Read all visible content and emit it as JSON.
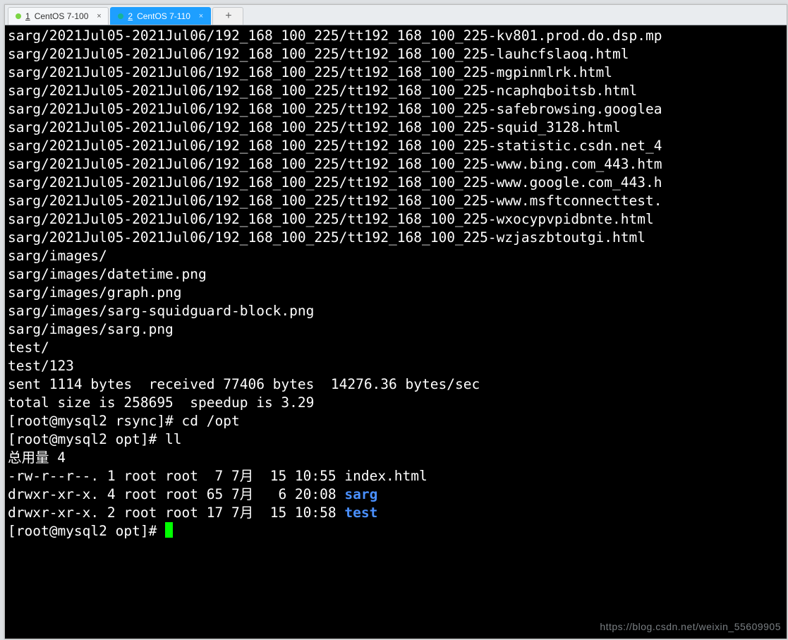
{
  "tabs": [
    {
      "num": "1",
      "label": "CentOS 7-100",
      "dotClass": "dot-green",
      "active": false
    },
    {
      "num": "2",
      "label": "CentOS 7-110",
      "dotClass": "dot-teal",
      "active": true
    }
  ],
  "addTab": "+",
  "sargPrefix": "sarg/2021Jul05-2021Jul06/192_168_100_225/tt192_168_100_225-",
  "sargFiles": [
    "kv801.prod.do.dsp.mp",
    "lauhcfslaoq.html",
    "mgpinmlrk.html",
    "ncaphqboitsb.html",
    "safebrowsing.googlea",
    "squid_3128.html",
    "statistic.csdn.net_4",
    "www.bing.com_443.htm",
    "www.google.com_443.h",
    "www.msftconnecttest.",
    "wxocypvpidbnte.html",
    "wzjaszbtoutgi.html"
  ],
  "extraLines": [
    "sarg/images/",
    "sarg/images/datetime.png",
    "sarg/images/graph.png",
    "sarg/images/sarg-squidguard-block.png",
    "sarg/images/sarg.png",
    "test/",
    "test/123"
  ],
  "blank": "",
  "transfer": {
    "sent": "sent 1114 bytes  received 77406 bytes  14276.36 bytes/sec",
    "total": "total size is 258695  speedup is 3.29"
  },
  "prompts": {
    "p1": "[root@mysql2 rsync]# cd /opt",
    "p2": "[root@mysql2 opt]# ll",
    "p3": "[root@mysql2 opt]# "
  },
  "ll": {
    "header": "总用量 4",
    "rows": [
      {
        "pre": "-rw-r--r--. 1 root root  7 7月  15 10:55 ",
        "name": "index.html",
        "isDir": false
      },
      {
        "pre": "drwxr-xr-x. 4 root root 65 7月   6 20:08 ",
        "name": "sarg",
        "isDir": true
      },
      {
        "pre": "drwxr-xr-x. 2 root root 17 7月  15 10:58 ",
        "name": "test",
        "isDir": true
      }
    ]
  },
  "watermark": "https://blog.csdn.net/weixin_55609905"
}
